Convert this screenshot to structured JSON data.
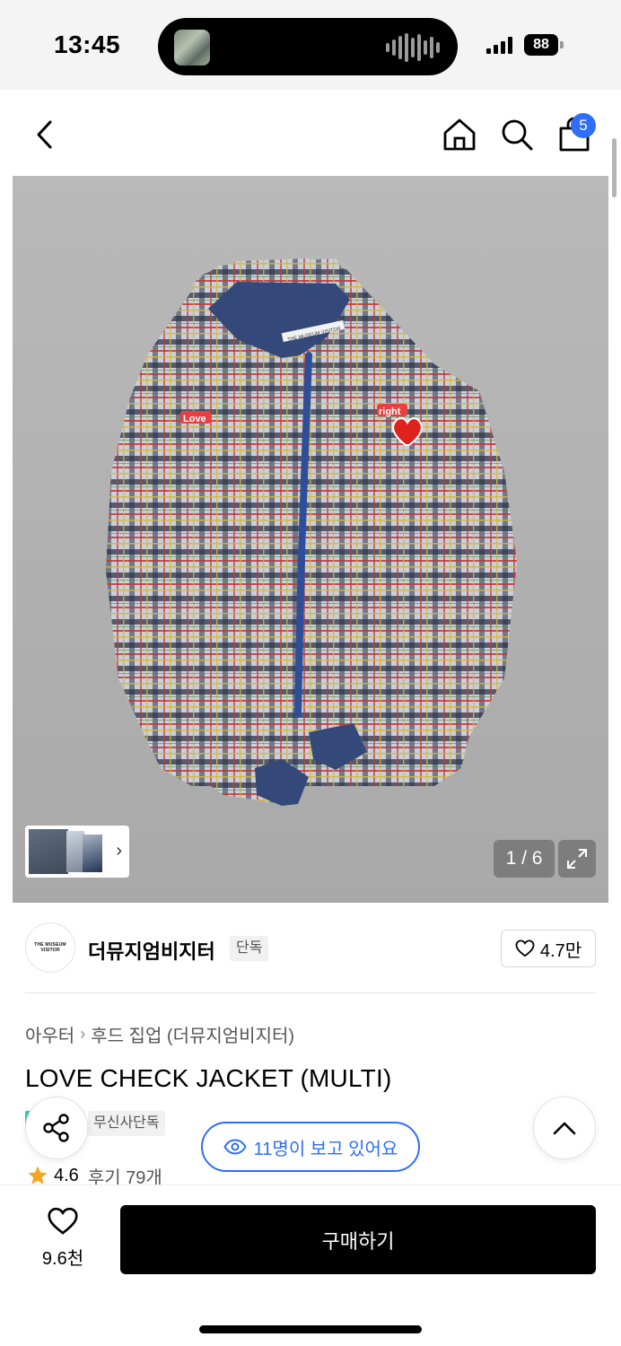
{
  "status_bar": {
    "time": "13:45",
    "battery": "88"
  },
  "nav": {
    "back_icon": "chevron-left-icon",
    "home_icon": "home-icon",
    "search_icon": "search-icon",
    "cart_icon": "shopping-bag-icon",
    "cart_count": "5"
  },
  "gallery": {
    "counter": "1 / 6",
    "expand_icon": "expand-icon",
    "patch_left": "Love",
    "patch_right": "right",
    "neck_label": "THE MUSEUM VISITOR"
  },
  "brand": {
    "logo_text": "THE MUSEUM VISITOR",
    "name": "더뮤지엄비지터",
    "exclusive_tag": "단독",
    "like_count": "4.7만"
  },
  "breadcrumb": {
    "category": "아우터",
    "subcategory": "후드 집업 (더뮤지엄비지터)"
  },
  "product": {
    "title": "LOVE CHECK JACKET (MULTI)",
    "musinsa_tag": "무신사단독",
    "viewers_text": "11명이 보고 있어요",
    "rating": "4.6",
    "review_text": "후기 79개"
  },
  "bottom_bar": {
    "wish_count": "9.6천",
    "buy_label": "구매하기"
  },
  "colors": {
    "accent": "#2f6ef5",
    "teal": "#2fc6c0",
    "star": "#f5a623"
  }
}
